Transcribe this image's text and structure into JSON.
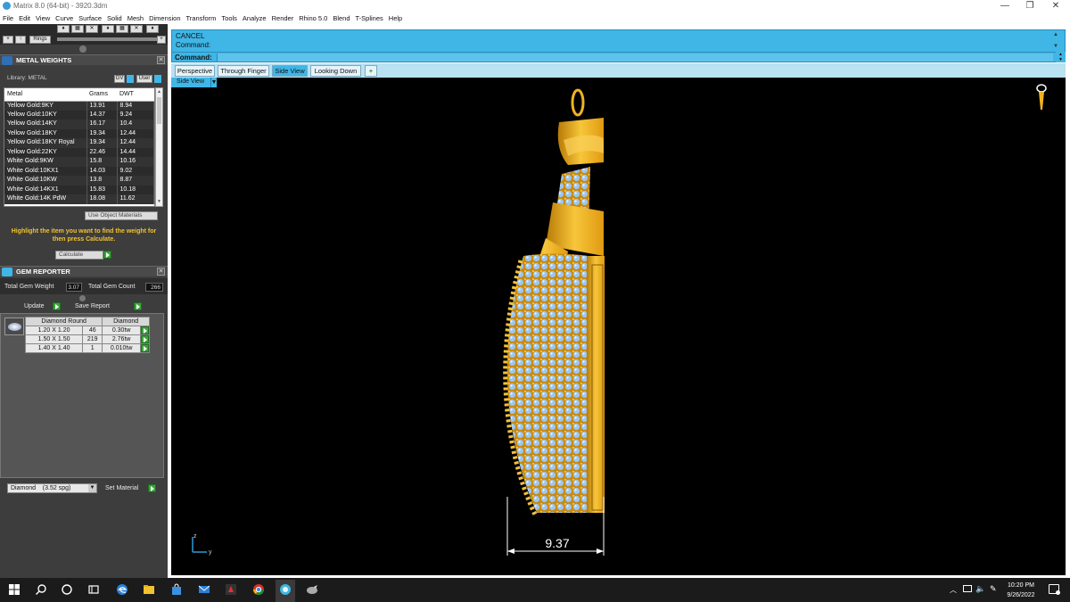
{
  "window": {
    "title": "Matrix 8.0 (64-bit) - 3920.3dm",
    "minimize": "—",
    "restore": "❐",
    "close": "✕"
  },
  "menu": [
    "File",
    "Edit",
    "View",
    "Curve",
    "Surface",
    "Solid",
    "Mesh",
    "Dimension",
    "Transform",
    "Tools",
    "Analyze",
    "Render",
    "Rhino 5.0",
    "Blend",
    "T-Splines",
    "Help"
  ],
  "toolbar": {
    "ring_label": "Rings"
  },
  "metal_weights": {
    "title": "METAL WEIGHTS",
    "library_label": "Library: METAL",
    "gv_label": "GV",
    "user_label": "User",
    "columns": [
      "Metal",
      "Grams",
      "DWT"
    ],
    "rows": [
      [
        "Yellow Gold:9KY",
        "13.91",
        "8.94"
      ],
      [
        "Yellow Gold:10KY",
        "14.37",
        "9.24"
      ],
      [
        "Yellow Gold:14KY",
        "16.17",
        "10.4"
      ],
      [
        "Yellow Gold:18KY",
        "19.34",
        "12.44"
      ],
      [
        "Yellow Gold:18KY Royal",
        "19.34",
        "12.44"
      ],
      [
        "Yellow Gold:22KY",
        "22.46",
        "14.44"
      ],
      [
        "White Gold:9KW",
        "15.8",
        "10.16"
      ],
      [
        "White Gold:10KX1",
        "14.03",
        "9.02"
      ],
      [
        "White Gold:10KW",
        "13.8",
        "8.87"
      ],
      [
        "White Gold:14KX1",
        "15.83",
        "10.18"
      ],
      [
        "White Gold:14K PdW",
        "18.08",
        "11.62"
      ]
    ],
    "use_object_materials": "Use Object Materials",
    "hint": "Highlight the item you want to find the weight for then press Calculate.",
    "calculate_label": "Calculate"
  },
  "gem_reporter": {
    "title": "GEM REPORTER",
    "total_weight_label": "Total Gem Weight",
    "total_weight_value": "3.07",
    "total_count_label": "Total Gem Count",
    "total_count_value": "266",
    "update_label": "Update",
    "save_report_label": "Save Report",
    "columns": [
      "Diamond Round",
      "",
      "Diamond"
    ],
    "rows": [
      [
        "1.20 X 1.20",
        "46",
        "0.30tw"
      ],
      [
        "1.50 X 1.50",
        "219",
        "2.76tw"
      ],
      [
        "1.40 X 1.40",
        "1",
        "0.010tw"
      ]
    ]
  },
  "material": {
    "selected": "Diamond    (3.52 spg)",
    "set_label": "Set Material"
  },
  "command": {
    "history_1": "CANCEL",
    "history_2": "Command:",
    "prompt_label": "Command:"
  },
  "viewport": {
    "tabs": [
      "Perspective",
      "Through Finger",
      "Side View",
      "Looking Down"
    ],
    "active_tab": "Side View",
    "add_tab": "+",
    "view_label": "Side View",
    "dimension": "9.37",
    "axis_z": "z",
    "axis_y": "y"
  },
  "taskbar": {
    "time": "10:20 PM",
    "date": "9/26/2022"
  },
  "colors": {
    "accent": "#3fb6e6",
    "gold": "#f2b21c",
    "gem_blue": "#9cc8f0"
  }
}
